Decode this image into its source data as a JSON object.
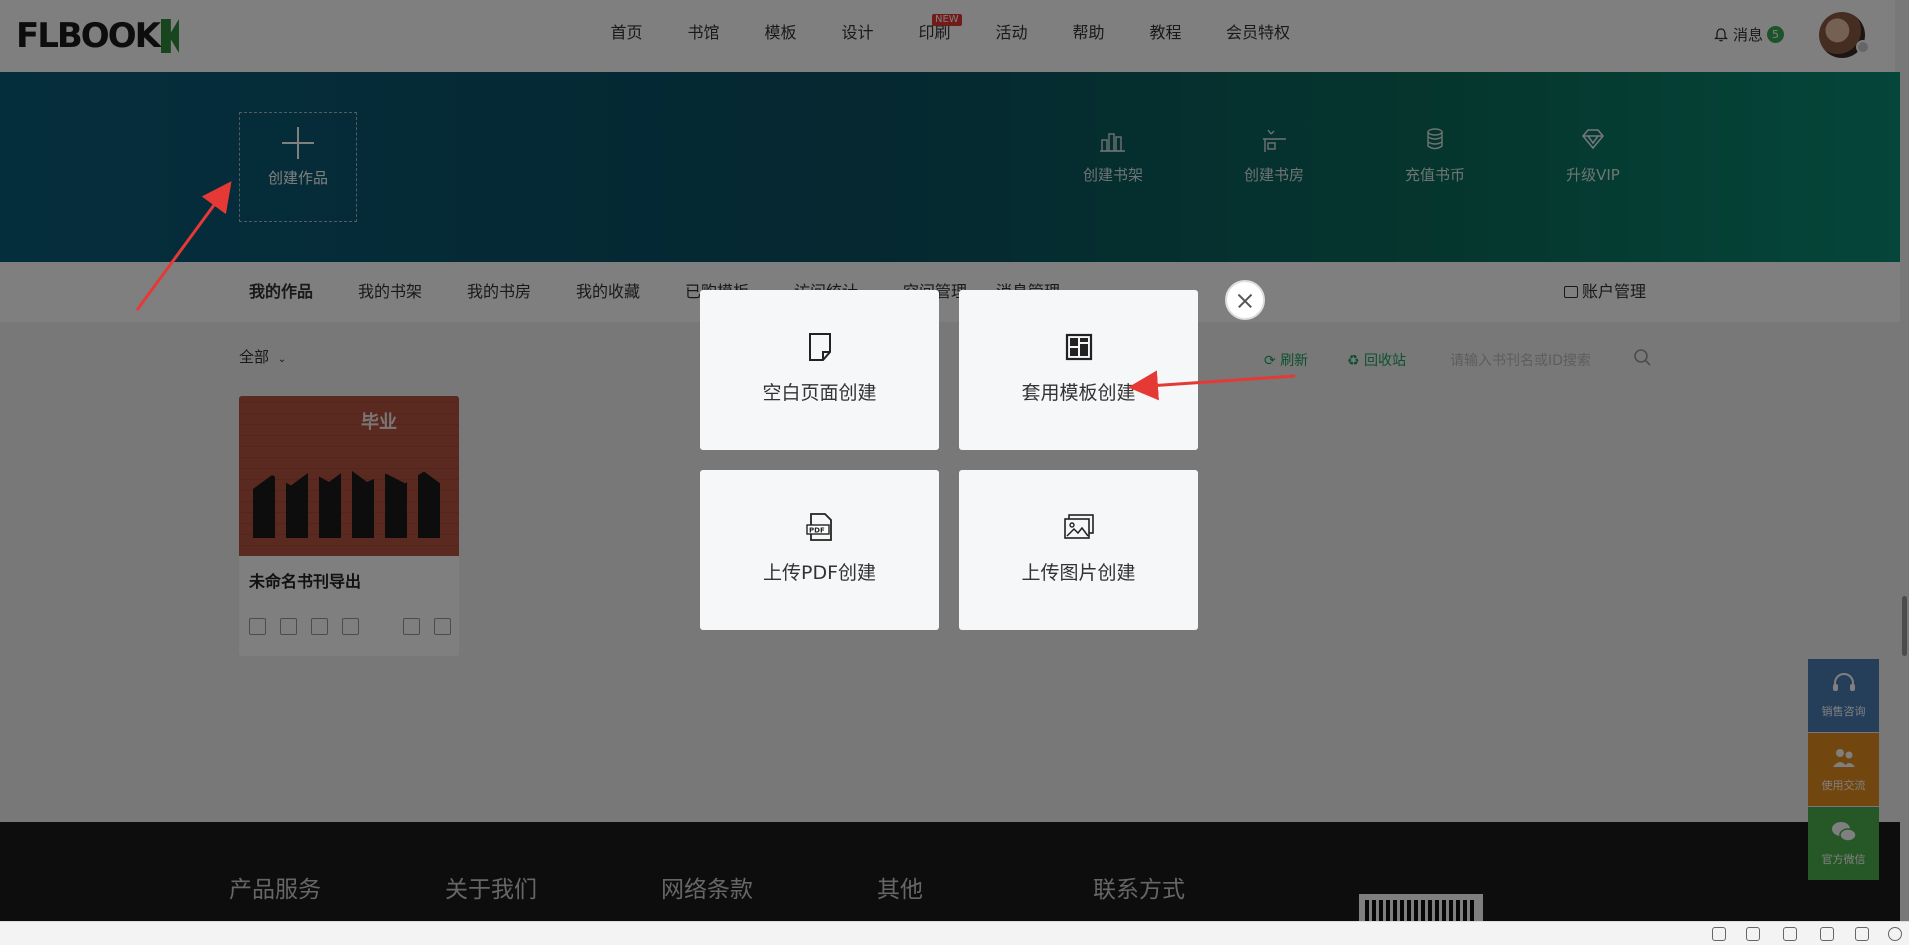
{
  "header": {
    "logo": "FLBOOK",
    "nav": [
      {
        "label": "首页"
      },
      {
        "label": "书馆"
      },
      {
        "label": "模板"
      },
      {
        "label": "设计"
      },
      {
        "label": "印刷",
        "badge": "NEW"
      },
      {
        "label": "活动"
      },
      {
        "label": "帮助"
      },
      {
        "label": "教程"
      },
      {
        "label": "会员特权"
      }
    ],
    "message_label": "消息",
    "message_count": "5"
  },
  "banner": {
    "create_label": "创建作品",
    "tools": [
      {
        "label": "创建书架",
        "icon": "bookshelf-icon"
      },
      {
        "label": "创建书房",
        "icon": "study-room-icon"
      },
      {
        "label": "充值书币",
        "icon": "coin-icon"
      },
      {
        "label": "升级VIP",
        "icon": "diamond-icon"
      }
    ]
  },
  "tabs": {
    "items": [
      "我的作品",
      "我的书架",
      "我的书房",
      "我的收藏",
      "已购模板",
      "访问统计",
      "空间管理",
      "消息管理"
    ],
    "active": "我的作品",
    "account_label": "账户管理"
  },
  "content": {
    "filter_label": "全部",
    "refresh_label": "刷新",
    "recycle_label": "回收站",
    "search_placeholder": "请输入书刊名或ID搜索",
    "card": {
      "title": "未命名书刊导出",
      "image_text": "毕业"
    }
  },
  "footer": {
    "columns": [
      "产品服务",
      "关于我们",
      "网络条款",
      "其他",
      "联系方式"
    ]
  },
  "side_buttons": [
    {
      "label": "销售咨询",
      "color": "#4a7fb5"
    },
    {
      "label": "使用交流",
      "color": "#e58c1f"
    },
    {
      "label": "官方微信",
      "color": "#4cae4c"
    }
  ],
  "modal": {
    "options": [
      {
        "label": "空白页面创建",
        "icon": "blank-page-icon"
      },
      {
        "label": "套用模板创建",
        "icon": "template-icon"
      },
      {
        "label": "上传PDF创建",
        "icon": "pdf-icon"
      },
      {
        "label": "上传图片创建",
        "icon": "image-icon"
      }
    ]
  },
  "colors": {
    "accent": "#1ba260",
    "banner_start": "#0b5c7a",
    "banner_end": "#0b8c74",
    "annotation_arrow": "#e53935"
  }
}
